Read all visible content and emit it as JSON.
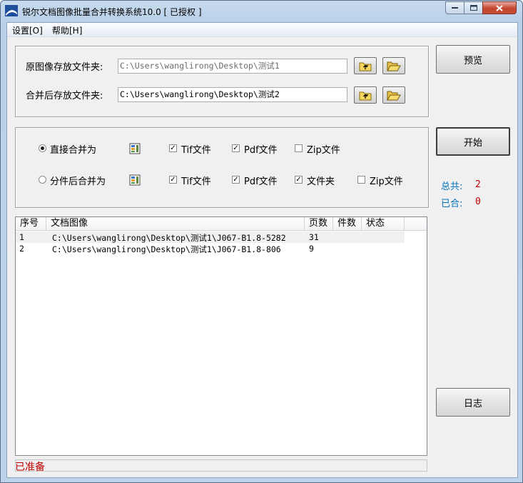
{
  "window": {
    "title": "锐尔文档图像批量合并转换系统10.0 [ 已授权 ]"
  },
  "menu": {
    "settings": "设置[O]",
    "help": "帮助[H]"
  },
  "folders": {
    "source_label": "原图像存放文件夹:",
    "source_path": "C:\\Users\\wanglirong\\Desktop\\测试1",
    "output_label": "合并后存放文件夹:",
    "output_path": "C:\\Users\\wanglirong\\Desktop\\测试2"
  },
  "options": {
    "direct_merge": {
      "label": "直接合并为",
      "selected": true,
      "tif": {
        "label": "Tif文件",
        "checked": true
      },
      "pdf": {
        "label": "Pdf文件",
        "checked": true
      },
      "zip": {
        "label": "Zip文件",
        "checked": false
      }
    },
    "split_merge": {
      "label": "分件后合并为",
      "selected": false,
      "tif": {
        "label": "Tif文件",
        "checked": true
      },
      "pdf": {
        "label": "Pdf文件",
        "checked": true
      },
      "folder": {
        "label": "文件夹",
        "checked": true
      },
      "zip": {
        "label": "Zip文件",
        "checked": false
      }
    }
  },
  "buttons": {
    "preview": "预览",
    "start": "开始",
    "log": "日志"
  },
  "stats": {
    "total_label": "总共:",
    "total_value": "2",
    "merged_label": "已合:",
    "merged_value": "0"
  },
  "table": {
    "columns": [
      "序号",
      "文档图像",
      "页数",
      "件数",
      "状态"
    ],
    "rows": [
      {
        "index": "1",
        "path": "C:\\Users\\wanglirong\\Desktop\\测试1\\J067-B1.8-5282",
        "pages": "31",
        "items": "",
        "status": ""
      },
      {
        "index": "2",
        "path": "C:\\Users\\wanglirong\\Desktop\\测试1\\J067-B1.8-806",
        "pages": "9",
        "items": "",
        "status": ""
      }
    ]
  },
  "statusbar": {
    "text": "已准备"
  },
  "colors": {
    "status_text": "#c00000",
    "stat_label": "#0070c0",
    "stat_value": "#c00000"
  }
}
